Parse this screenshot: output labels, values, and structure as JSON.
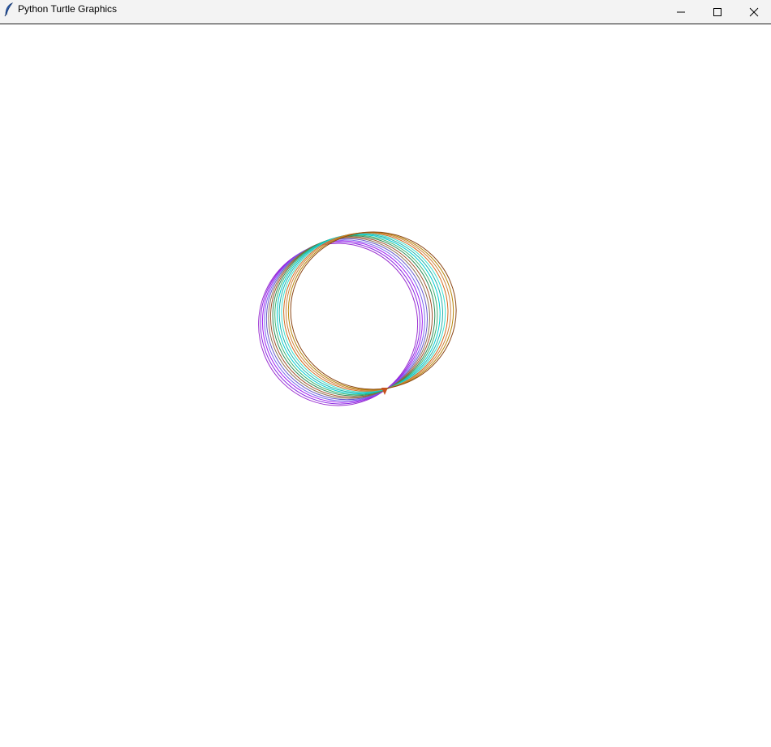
{
  "window": {
    "title": "Python Turtle Graphics",
    "icon": "feather-icon",
    "controls": {
      "minimize_icon": "minimize-icon",
      "maximize_icon": "maximize-icon",
      "close_icon": "close-icon"
    }
  },
  "drawing": {
    "background": "#ffffff",
    "stroke_colors": [
      "#9b30d0",
      "#8a2be2",
      "#a020f0",
      "#7b68ee",
      "#6a5acd",
      "#8b7355",
      "#a0522d",
      "#2e8b57",
      "#3cb371",
      "#00ced1",
      "#20b2aa",
      "#40e0d0",
      "#d2691e",
      "#cd853f",
      "#b8860b",
      "#8b4513"
    ],
    "turtle_color": "#c8501e"
  }
}
